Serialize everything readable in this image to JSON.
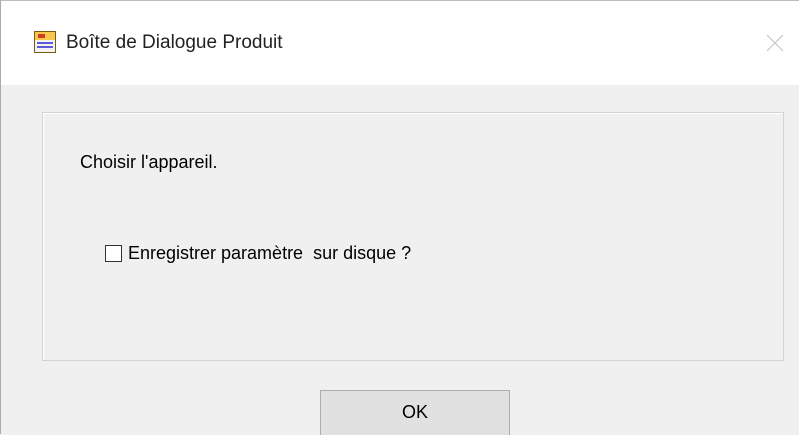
{
  "window": {
    "title": "Boîte de Dialogue Produit",
    "icon": "application-icon",
    "close_icon": "close-icon"
  },
  "content": {
    "prompt": "Choisir l'appareil.",
    "checkbox": {
      "label": "Enregistrer paramètre  sur disque ?",
      "checked": false
    }
  },
  "buttons": {
    "ok_label": "OK"
  },
  "colors": {
    "background": "#f0f0f0",
    "titlebar": "#ffffff",
    "button_face": "#e1e1e1",
    "button_border": "#adadad",
    "group_border": "#d3d3d3"
  }
}
